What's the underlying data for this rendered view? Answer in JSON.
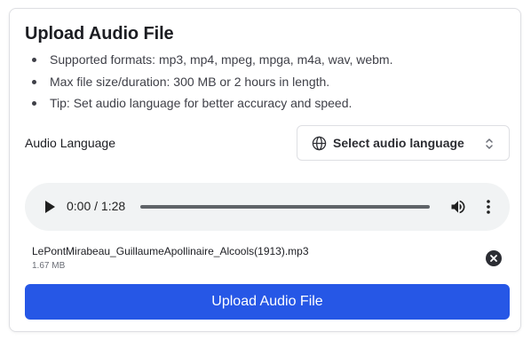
{
  "card": {
    "title": "Upload Audio File",
    "tips": [
      "Supported formats: mp3, mp4, mpeg, mpga, m4a, wav, webm.",
      "Max file size/duration: 300 MB or 2 hours in length.",
      "Tip: Set audio language for better accuracy and speed."
    ]
  },
  "language": {
    "label": "Audio Language",
    "select_text": "Select audio language",
    "icon": "globe-icon",
    "chevron_icon": "chevron-up-down-icon"
  },
  "player": {
    "time": "0:00 / 1:28",
    "progress_fraction": 0,
    "play_icon": "play-icon",
    "volume_icon": "volume-icon",
    "more_icon": "more-vertical-icon"
  },
  "file": {
    "name": "LePontMirabeau_GuillaumeApollinaire_Alcools(1913).mp3",
    "size": "1.67 MB",
    "remove_icon": "close-circle-icon"
  },
  "upload_button": {
    "label": "Upload Audio File",
    "color": "#2657e6"
  }
}
